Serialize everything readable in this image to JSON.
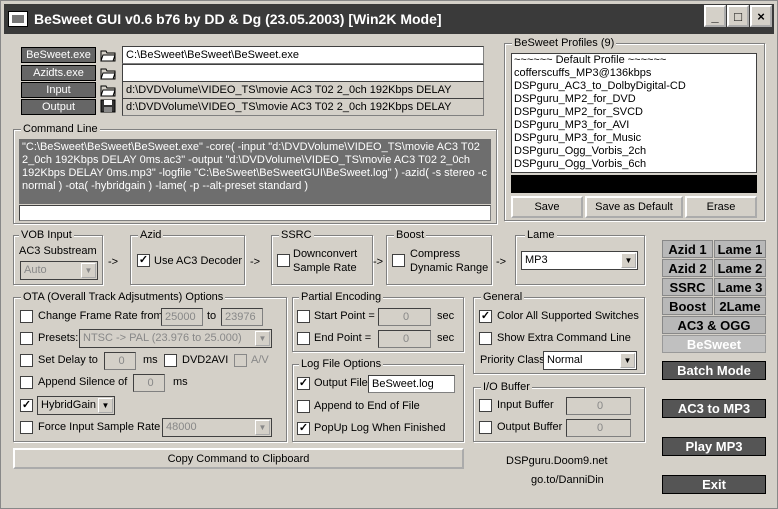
{
  "window": {
    "title": "BeSweet GUI v0.6 b76 by DD & Dg (23.05.2003)  [Win2K Mode]",
    "minimize": "_",
    "maximize": "□",
    "close": "×"
  },
  "paths": {
    "besweet_label": "BeSweet.exe",
    "besweet_value": "C:\\BeSweet\\BeSweet\\BeSweet.exe",
    "azidts_label": "Azidts.exe",
    "azidts_value": "",
    "input_label": "Input",
    "input_value": "d:\\DVDVolume\\VIDEO_TS\\movie AC3 T02 2_0ch 192Kbps DELAY",
    "output_label": "Output",
    "output_value": "d:\\DVDVolume\\VIDEO_TS\\movie AC3 T02 2_0ch 192Kbps DELAY"
  },
  "profiles": {
    "title": "BeSweet Profiles (9)",
    "items": [
      "~~~~~~ Default Profile ~~~~~~",
      "cofferscuffs_MP3@136kbps",
      "DSPguru_AC3_to_DolbyDigital-CD",
      "DSPguru_MP2_for_DVD",
      "DSPguru_MP2_for_SVCD",
      "DSPguru_MP3_for_AVI",
      "DSPguru_MP3_for_Music",
      "DSPguru_Ogg_Vorbis_2ch",
      "DSPguru_Ogg_Vorbis_6ch"
    ],
    "save": "Save",
    "save_default": "Save as Default",
    "erase": "Erase"
  },
  "command": {
    "label": "Command Line",
    "text": "\"C:\\BeSweet\\BeSweet\\BeSweet.exe\" -core( -input \"d:\\DVDVolume\\VIDEO_TS\\movie AC3 T02 2_0ch 192Kbps DELAY 0ms.ac3\" -output \"d:\\DVDVolume\\VIDEO_TS\\movie AC3 T02 2_0ch 192Kbps DELAY 0ms.mp3\" -logfile \"C:\\BeSweet\\BeSweetGUI\\BeSweet.log\" ) -azid( -s stereo -c normal ) -ota( -hybridgain ) -lame( -p --alt-preset standard )"
  },
  "chain": {
    "vob_title": "VOB Input",
    "vob_sub": "AC3 Substream",
    "vob_select": "Auto",
    "azid_title": "Azid",
    "azid_check": "Use AC3 Decoder",
    "ssrc_title": "SSRC",
    "ssrc_check1": "Downconvert",
    "ssrc_check2": "Sample Rate",
    "boost_title": "Boost",
    "boost_check1": "Compress",
    "boost_check2": "Dynamic Range",
    "lame_title": "Lame",
    "lame_select": "MP3",
    "arrow": "->"
  },
  "ota": {
    "title": "OTA (Overall Track Adjsutments) Options",
    "frame_rate": "Change Frame Rate from",
    "frame_from": "25000",
    "frame_to_label": "to",
    "frame_to": "23976",
    "presets": "Presets:",
    "presets_value": "NTSC -> PAL    (23.976 to 25.000)",
    "set_delay": "Set Delay to",
    "delay_value": "0",
    "ms": "ms",
    "dvd2avi": "DVD2AVI",
    "av": "A/V",
    "append_silence": "Append Silence of",
    "silence_value": "0",
    "hybrid": "HybridGain",
    "force_rate": "Force Input Sample Rate",
    "force_rate_value": "48000"
  },
  "partial": {
    "title": "Partial Encoding",
    "start": "Start Point =",
    "start_value": "0",
    "end": "End Point =",
    "end_value": "0",
    "sec": "sec"
  },
  "log": {
    "title": "Log File Options",
    "output_file": "Output File",
    "output_value": "BeSweet.log",
    "append": "Append to End of File",
    "popup": "PopUp Log When Finished"
  },
  "general": {
    "title": "General",
    "color_switches": "Color All Supported Switches",
    "extra_cmd": "Show Extra Command Line",
    "priority_label": "Priority Class",
    "priority_value": "Normal"
  },
  "io": {
    "title": "I/O Buffer",
    "input": "Input Buffer",
    "input_value": "0",
    "output": "Output Buffer",
    "output_value": "0"
  },
  "copy_button": "Copy Command to Clipboard",
  "links": {
    "site1": "DSPguru.Doom9.net",
    "site2": "go.to/DanniDin"
  },
  "modes": {
    "azid1": "Azid 1",
    "lame1": "Lame 1",
    "azid2": "Azid 2",
    "lame2": "Lame 2",
    "ssrc": "SSRC",
    "lame3": "Lame 3",
    "boost": "Boost",
    "twolame": "2Lame",
    "ac3ogg": "AC3 & OGG",
    "besweet": "BeSweet"
  },
  "actions": {
    "batch": "Batch Mode",
    "ac3mp3": "AC3 to MP3",
    "play": "Play MP3",
    "exit": "Exit"
  }
}
